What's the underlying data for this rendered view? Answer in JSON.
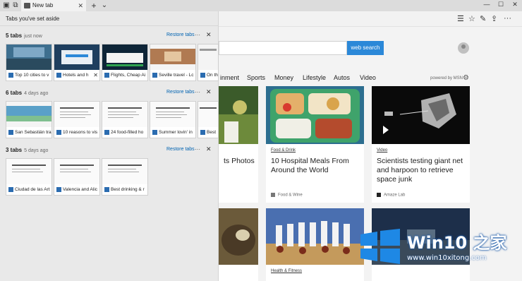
{
  "browser": {
    "active_tab_title": "New tab",
    "close_glyph": "✕",
    "new_tab_glyph": "+",
    "tab_menu_glyph": "⌄",
    "window": {
      "minimize": "—",
      "maximize": "☐",
      "close": "✕"
    },
    "toolbar_icons": [
      "reading-icon",
      "favorites-icon",
      "notes-icon",
      "share-icon",
      "more-icon"
    ]
  },
  "page": {
    "search_button": "web search",
    "nav": [
      "inment",
      "Sports",
      "Money",
      "Lifestyle",
      "Autos",
      "Video"
    ],
    "powered_by": "powered by MSN",
    "cards": [
      {
        "category": "",
        "title": "ts Photos",
        "source": ""
      },
      {
        "category": "Food & Drink",
        "title": "10 Hospital Meals From Around the World",
        "source": "Food & Wine"
      },
      {
        "category": "Video",
        "title": "Scientists testing giant net and harpoon to retrieve space junk",
        "source": "Amaze Lab"
      },
      {
        "category": "Health & Fitness",
        "title": "",
        "source": ""
      }
    ]
  },
  "aside": {
    "heading": "Tabs you've set aside",
    "restore_label": "Restore tabs",
    "more_glyph": "···",
    "close_glyph": "✕",
    "groups": [
      {
        "count_label": "5 tabs",
        "time": "just now",
        "tabs": [
          "Top 10 cities to v",
          "Hotels and h",
          "Flights, Cheap Ai",
          "Seville travel - Lc",
          "On th"
        ]
      },
      {
        "count_label": "6 tabs",
        "time": "4 days ago",
        "tabs": [
          "San Sebastián tra",
          "10 reasons to vis",
          "24 food-filled ho",
          "Summer lovin' in",
          "Best"
        ]
      },
      {
        "count_label": "3 tabs",
        "time": "5 days ago",
        "tabs": [
          "Ciudad de las Art",
          "Valencia and Alic",
          "Best drinking & r"
        ]
      }
    ]
  },
  "watermark": {
    "brand": "Win10 之家",
    "url": "www.win10xitong.com"
  }
}
